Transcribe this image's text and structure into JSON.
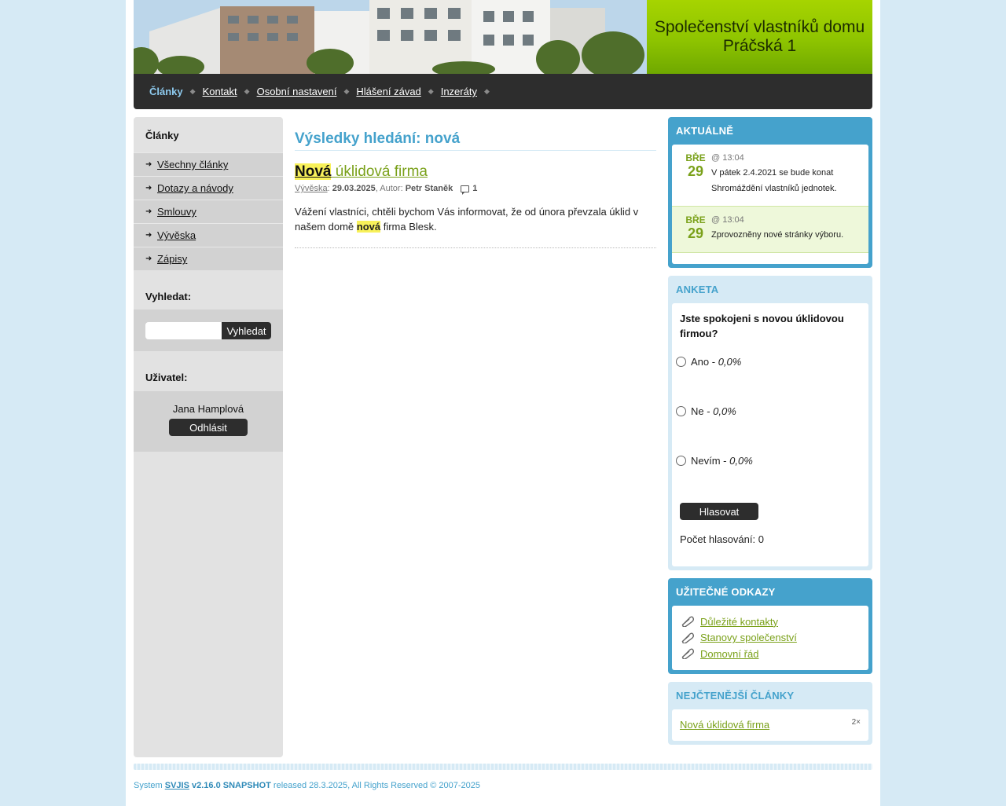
{
  "header": {
    "title": "Společenství vlastníků domu Práčská 1"
  },
  "nav": {
    "items": [
      {
        "label": "Články",
        "active": true
      },
      {
        "label": "Kontakt"
      },
      {
        "label": "Osobní nastavení"
      },
      {
        "label": "Hlášení závad"
      },
      {
        "label": "Inzeráty"
      }
    ]
  },
  "sidebar": {
    "articles_title": "Články",
    "items": [
      {
        "label": "Všechny články"
      },
      {
        "label": "Dotazy a návody"
      },
      {
        "label": "Smlouvy"
      },
      {
        "label": "Vývěska"
      },
      {
        "label": "Zápisy"
      }
    ],
    "search_title": "Vyhledat:",
    "search_value": "",
    "search_button": "Vyhledat",
    "user_title": "Uživatel:",
    "user_name": "Jana Hamplová",
    "logout_button": "Odhlásit"
  },
  "main": {
    "results_title": "Výsledky hledání: nová",
    "article": {
      "title_highlight": "Nová",
      "title_rest": " úklidová firma",
      "category": "Vývěska",
      "date": "29.03.2025",
      "author_label": ", Autor: ",
      "author": "Petr Staněk",
      "comments": "1",
      "excerpt_before": "Vážení vlastníci, chtěli bychom Vás informovat, že od února převzala úklid v našem domě ",
      "excerpt_highlight": "nová",
      "excerpt_after": " firma Blesk."
    }
  },
  "news": {
    "title": "AKTUÁLNĚ",
    "items": [
      {
        "month": "BŘE",
        "day": "29",
        "time": "@ 13:04",
        "text": "V pátek 2.4.2021 se bude konat Shromáždění vlastníků jednotek."
      },
      {
        "month": "BŘE",
        "day": "29",
        "time": "@ 13:04",
        "text": "Zprovozněny nové stránky výboru."
      }
    ]
  },
  "poll": {
    "title": "ANKETA",
    "question": "Jste spokojeni s novou úklidovou firmou?",
    "options": [
      {
        "label": "Ano - ",
        "percent": "0,0%"
      },
      {
        "label": "Ne - ",
        "percent": "0,0%"
      },
      {
        "label": "Nevím - ",
        "percent": "0,0%"
      }
    ],
    "vote_button": "Hlasovat",
    "count_text": "Počet hlasování: 0"
  },
  "links": {
    "title": "UŽITEČNÉ ODKAZY",
    "items": [
      {
        "label": "Důležité kontakty",
        "icon": "paperclip-icon"
      },
      {
        "label": "Stanovy společenství",
        "icon": "paperclip-icon"
      },
      {
        "label": "Domovní řád",
        "icon": "paperclip-icon"
      }
    ]
  },
  "top_articles": {
    "title": "NEJČTENĚJŠÍ ČLÁNKY",
    "items": [
      {
        "label": "Nová úklidová firma",
        "count": "2×"
      }
    ]
  },
  "footer": {
    "prefix": "System ",
    "system": "SVJIS",
    "version": "v2.16.0 SNAPSHOT",
    "suffix": " released 28.3.2025, All Rights Reserved © 2007-2025"
  },
  "colors": {
    "accent_blue": "#45a2cc",
    "accent_green": "#7aa11a",
    "highlight": "#f8f15a",
    "dark": "#2d2d2d"
  }
}
